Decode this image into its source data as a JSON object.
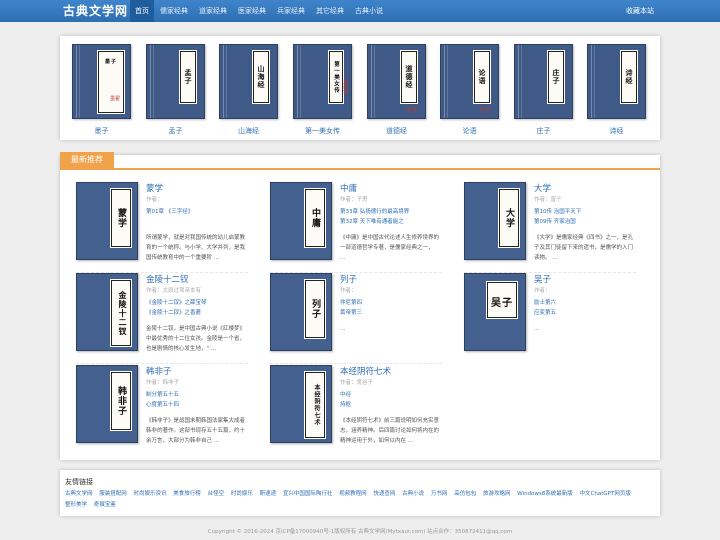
{
  "header": {
    "logo": "古典文学网",
    "nav": [
      "首页",
      "儒家经典",
      "道家经典",
      "医家经典",
      "兵家经典",
      "其它经典",
      "古典小说"
    ],
    "favorite": "收藏本站"
  },
  "featured": [
    {
      "title": "墨子",
      "cover": "墨子",
      "seal": "墨翟"
    },
    {
      "title": "孟子",
      "cover": "孟子"
    },
    {
      "title": "山海经",
      "cover": "山海经"
    },
    {
      "title": "第一美女传",
      "cover": "第一美女传",
      "seal": "素政堂"
    },
    {
      "title": "道德经",
      "cover": "道德经",
      "seal": "老子"
    },
    {
      "title": "论语",
      "cover": "论语",
      "seal": "孔子"
    },
    {
      "title": "庄子",
      "cover": "庄子"
    },
    {
      "title": "诗经",
      "cover": "诗经"
    }
  ],
  "section": {
    "title": "最新推荐"
  },
  "items": [
    {
      "title": "蒙学",
      "cover": "蒙学",
      "author": "作者：",
      "link1": "第01章 《三字经》",
      "link2": "",
      "desc": "所谓蒙学，就是对我国传统的幼儿启蒙教育的一个统称。与小学、大学并列，是我国传统教育中的一个重要阶 ..."
    },
    {
      "title": "中庸",
      "cover": "中庸",
      "author": "作者：子思",
      "link1": "第33章 弘扬德行的最高境界",
      "link2": "第32章 天下唯有通者能之",
      "desc": "《中庸》是中国古代论述人生修养境界的一部道德哲学专著，是儒家经典之一， ..."
    },
    {
      "title": "大学",
      "cover": "大学",
      "author": "作者：曾子",
      "link1": "第10传 治国平天下",
      "link2": "第09传 齐家治国",
      "desc": "《大学》是儒家经典《四书》之一，是孔子及其门徒留下来的遗书，是儒学的入门读物。 ..."
    },
    {
      "title": "金陵十二钗",
      "cover": "金陵十二钗",
      "author": "作者：太原过驾亲本有",
      "link1": "《金陵十二钗》之薛宝琴",
      "link2": "《金陵十二钗》之香菱",
      "desc": "金陵十二钗，是中国古典小说《红楼梦》中最优秀的十二位女孩。金陵是一个省，也是剧情的核心发生地，\" ..."
    },
    {
      "title": "列子",
      "cover": "列子",
      "author": "作者：",
      "link1": "仲尼第四",
      "link2": "黄帝第三",
      "desc": "..."
    },
    {
      "title": "吴子",
      "cover": "吴子",
      "author": "作者：",
      "link1": "励士第六",
      "link2": "应变第五",
      "desc": "..."
    },
    {
      "title": "韩非子",
      "cover": "韩非子",
      "author": "作者：韩非子",
      "link1": "制分第五十五",
      "link2": "心度第五十四",
      "desc": "《韩非子》是战国末期韩国法家集大成者韩非的著作。这部书现存五十五篇，约十余万言，大部分为韩非自己 ..."
    },
    {
      "title": "本经阴符七术",
      "cover": "本经阴符七术",
      "author": "作者：鬼谷子",
      "link1": "中经",
      "link2": "持枢",
      "desc": "《本经阴符七术》前三篇说明如何充实意志，涵养精神。后四篇讨论如何将内在的精神运用于外，如何以内在 ..."
    }
  ],
  "friend_links": {
    "title": "友情链接",
    "items": [
      "古典文学网",
      "服装搭配网",
      "时尚娱乐资讯",
      "美食旅行榜",
      "台怪空",
      "时尚娱乐",
      "斯速递",
      "宣兴中国国际陶行社",
      "视频教程网",
      "快递查网",
      "古典小说",
      "万书网",
      "高仿包包",
      "旅游攻略网",
      "Windows8系统最新版",
      "中文ChatGPT网页版",
      "整形美学",
      "奇撰宝鉴"
    ]
  },
  "footer": "Copyright © 2016-2024 京ICP备17000940号-1版权所有 古典文学网(Mytxaur.com) 站点合作：350872411@qq.com"
}
